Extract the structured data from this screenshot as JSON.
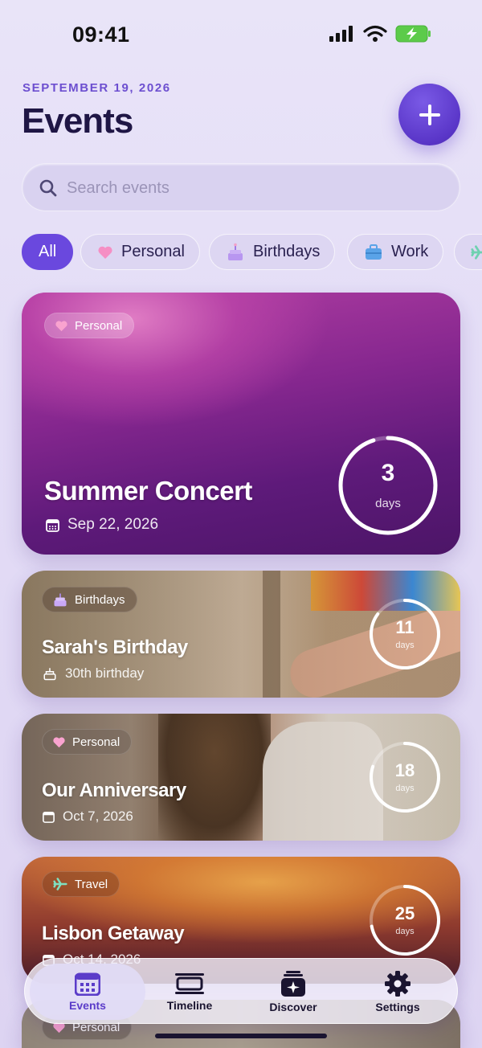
{
  "status": {
    "time": "09:41"
  },
  "header": {
    "date": "SEPTEMBER 19, 2026",
    "title": "Events"
  },
  "search": {
    "placeholder": "Search events"
  },
  "filters": [
    "All",
    "Personal",
    "Birthdays",
    "Work"
  ],
  "events": [
    {
      "tag": "Personal",
      "title": "Summer Concert",
      "subtitle": "Sep 22, 2026",
      "count": "3",
      "unit": "days",
      "progress": 0.95
    },
    {
      "tag": "Birthdays",
      "title": "Sarah's Birthday",
      "subtitle": "30th birthday",
      "count": "11",
      "unit": "days",
      "progress": 0.85
    },
    {
      "tag": "Personal",
      "title": "Our Anniversary",
      "subtitle": "Oct 7, 2026",
      "count": "18",
      "unit": "days",
      "progress": 0.8
    },
    {
      "tag": "Travel",
      "title": "Lisbon Getaway",
      "subtitle": "Oct 14, 2026",
      "count": "25",
      "unit": "days",
      "progress": 0.72
    },
    {
      "tag": "Personal"
    }
  ],
  "tabs": [
    "Events",
    "Timeline",
    "Discover",
    "Settings"
  ],
  "colors": {
    "accent": "#6a48de",
    "title": "#1f1645",
    "date": "#6d4fd0"
  }
}
